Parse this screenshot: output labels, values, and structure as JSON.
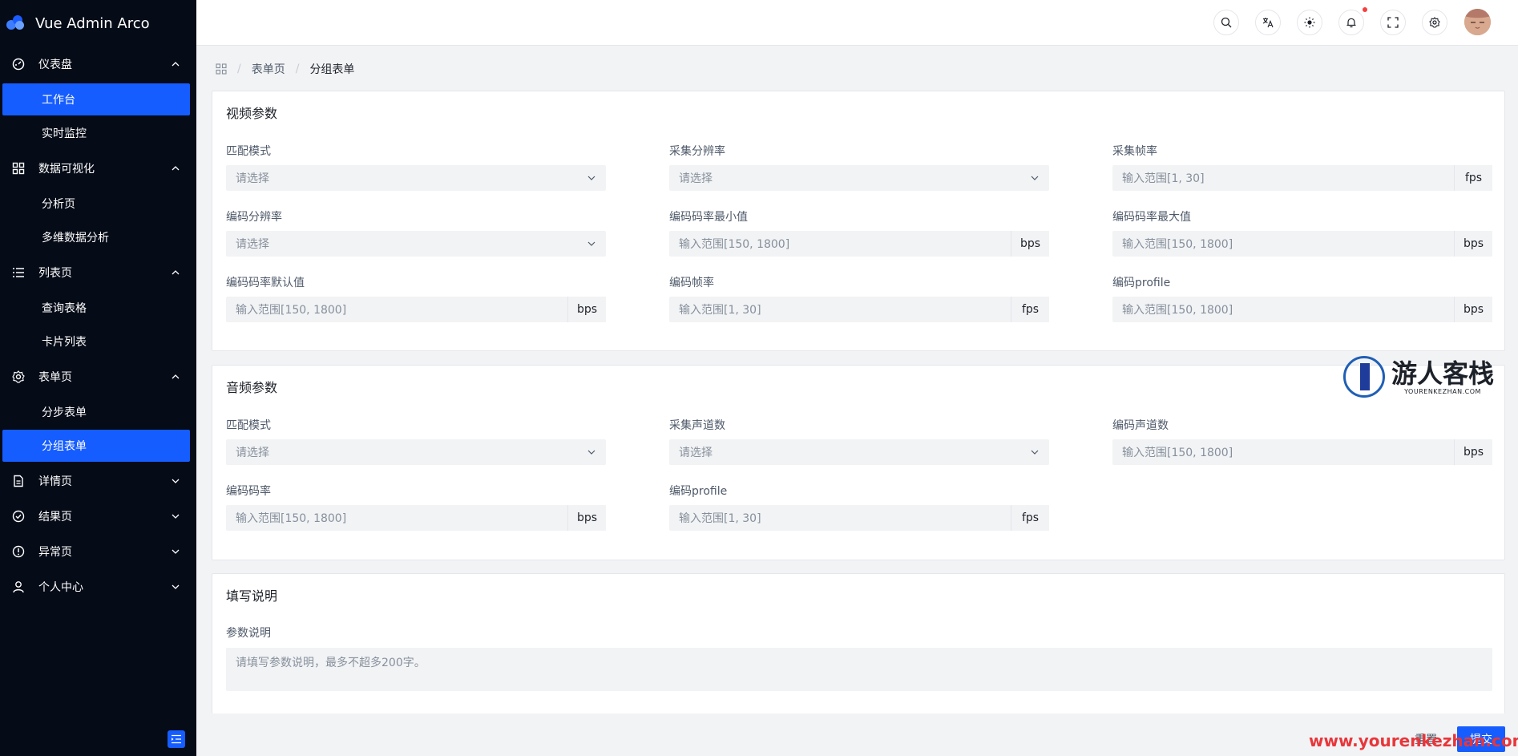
{
  "app": {
    "title": "Vue Admin Arco"
  },
  "sidebar": {
    "groups": [
      {
        "label": "仪表盘",
        "icon": "dashboard-icon",
        "expanded": true,
        "items": [
          {
            "label": "工作台",
            "active": true
          },
          {
            "label": "实时监控",
            "active": false
          }
        ]
      },
      {
        "label": "数据可视化",
        "icon": "apps-icon",
        "expanded": true,
        "items": [
          {
            "label": "分析页",
            "active": false
          },
          {
            "label": "多维数据分析",
            "active": false
          }
        ]
      },
      {
        "label": "列表页",
        "icon": "list-icon",
        "expanded": true,
        "items": [
          {
            "label": "查询表格",
            "active": false
          },
          {
            "label": "卡片列表",
            "active": false
          }
        ]
      },
      {
        "label": "表单页",
        "icon": "settings-icon",
        "expanded": true,
        "items": [
          {
            "label": "分步表单",
            "active": false
          },
          {
            "label": "分组表单",
            "active": true
          }
        ]
      },
      {
        "label": "详情页",
        "icon": "file-icon",
        "expanded": false,
        "items": []
      },
      {
        "label": "结果页",
        "icon": "check-circle-icon",
        "expanded": false,
        "items": []
      },
      {
        "label": "异常页",
        "icon": "exclamation-circle-icon",
        "expanded": false,
        "items": []
      },
      {
        "label": "个人中心",
        "icon": "user-icon",
        "expanded": false,
        "items": []
      }
    ]
  },
  "header": {
    "icons": [
      "search-icon",
      "language-icon",
      "theme-icon",
      "notification-icon",
      "fullscreen-icon",
      "settings-icon"
    ],
    "has_notification": true
  },
  "breadcrumb": {
    "items": [
      "表单页",
      "分组表单"
    ]
  },
  "video": {
    "title": "视频参数",
    "match_mode": {
      "label": "匹配模式",
      "placeholder": "请选择"
    },
    "capture_resolution": {
      "label": "采集分辨率",
      "placeholder": "请选择"
    },
    "capture_fps": {
      "label": "采集帧率",
      "placeholder": "输入范围[1, 30]",
      "suffix": "fps"
    },
    "encode_resolution": {
      "label": "编码分辨率",
      "placeholder": "请选择"
    },
    "encode_bitrate_min": {
      "label": "编码码率最小值",
      "placeholder": "输入范围[150, 1800]",
      "suffix": "bps"
    },
    "encode_bitrate_max": {
      "label": "编码码率最大值",
      "placeholder": "输入范围[150, 1800]",
      "suffix": "bps"
    },
    "encode_bitrate_default": {
      "label": "编码码率默认值",
      "placeholder": "输入范围[150, 1800]",
      "suffix": "bps"
    },
    "encode_fps": {
      "label": "编码帧率",
      "placeholder": "输入范围[1, 30]",
      "suffix": "fps"
    },
    "encode_profile": {
      "label": "编码profile",
      "placeholder": "输入范围[150, 1800]",
      "suffix": "bps"
    }
  },
  "audio": {
    "title": "音频参数",
    "match_mode": {
      "label": "匹配模式",
      "placeholder": "请选择"
    },
    "capture_channels": {
      "label": "采集声道数",
      "placeholder": "请选择"
    },
    "encode_channels": {
      "label": "编码声道数",
      "placeholder": "输入范围[150, 1800]",
      "suffix": "bps"
    },
    "encode_bitrate": {
      "label": "编码码率",
      "placeholder": "输入范围[150, 1800]",
      "suffix": "bps"
    },
    "encode_profile": {
      "label": "编码profile",
      "placeholder": "输入范围[1, 30]",
      "suffix": "fps"
    }
  },
  "description": {
    "title": "填写说明",
    "label": "参数说明",
    "placeholder": "请填写参数说明，最多不超多200字。"
  },
  "actions": {
    "reset": "重置",
    "submit": "提交"
  },
  "watermark": {
    "name": "游人客栈",
    "domain": "YOURENKEZHAN.COM",
    "url": "www.yourenkezhan.com"
  },
  "colors": {
    "primary": "#165dff",
    "sidebar_bg": "#050b17",
    "page_bg": "#f2f3f5",
    "watermark_red": "#e8363a"
  }
}
